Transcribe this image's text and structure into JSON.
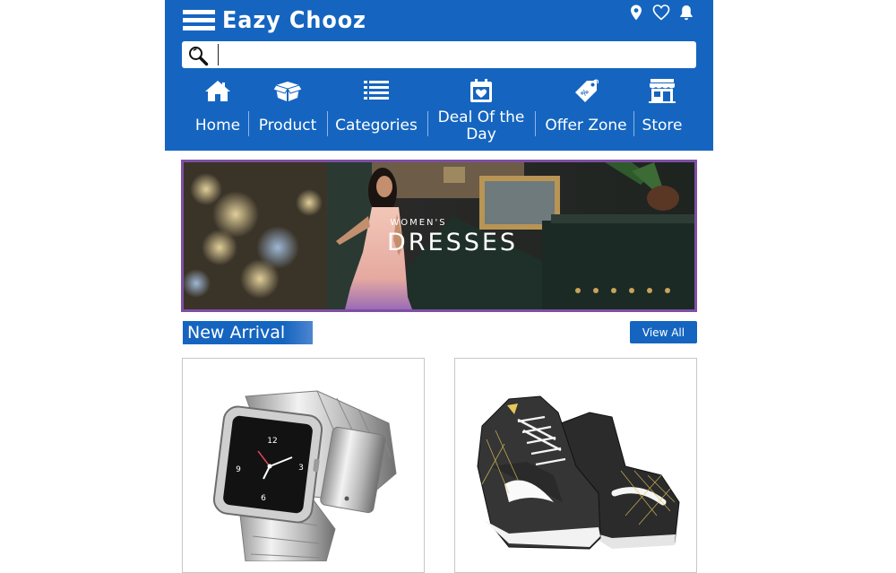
{
  "brand": {
    "name": "Eazy Chooz"
  },
  "header_icons": [
    "location-pin-icon",
    "heart-icon",
    "bell-icon"
  ],
  "search": {
    "value": "",
    "placeholder": ""
  },
  "nav": [
    {
      "label": "Home",
      "icon": "home-icon"
    },
    {
      "label": "Product",
      "icon": "box-icon"
    },
    {
      "label": "Categories",
      "icon": "list-icon"
    },
    {
      "label": "Deal Of the Day",
      "icon": "calendar-heart-icon"
    },
    {
      "label": "Offer Zone",
      "icon": "tag-icon"
    },
    {
      "label": "Store",
      "icon": "store-icon"
    }
  ],
  "banner": {
    "kicker": "WOMEN'S",
    "headline": "DRESSES"
  },
  "new_arrival": {
    "title": "New Arrival",
    "view_all_label": "View All"
  },
  "products": [
    {
      "kind": "watch-image",
      "watch_numbers": [
        "12",
        "3",
        "6",
        "9"
      ]
    },
    {
      "kind": "sneakers-image"
    }
  ],
  "colors": {
    "brand_blue": "#1565c0",
    "banner_border": "#7e4fa3",
    "card_border": "#c7c7c7"
  }
}
